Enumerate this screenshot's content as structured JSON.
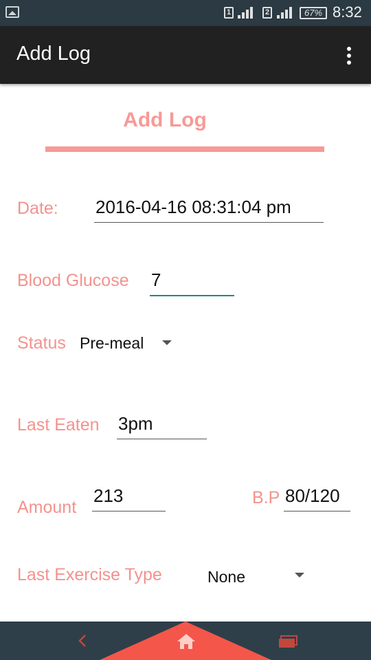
{
  "status_bar": {
    "sim1": "1",
    "sim2": "2",
    "battery": "67%",
    "time": "8:32"
  },
  "app_bar": {
    "title": "Add Log"
  },
  "form": {
    "heading": "Add Log",
    "date_label": "Date:",
    "date_value": "2016-04-16 08:31:04 pm",
    "glucose_label": "Blood Glucose",
    "glucose_value": "7",
    "status_label": "Status",
    "status_value": "Pre-meal",
    "last_eaten_label": "Last Eaten",
    "last_eaten_value": "3pm",
    "amount_label": "Amount",
    "amount_value": "213",
    "bp_label": "B.P",
    "bp_value": "80/120",
    "exercise_label": "Last Exercise Type",
    "exercise_value": "None"
  },
  "colors": {
    "accent": "#f4928d",
    "nav_accent": "#f4564a",
    "active_underline": "#1e8a7c",
    "app_bar": "#212121",
    "status_bar": "#2b3a43"
  },
  "icons": {
    "status_left": "gallery-icon",
    "menu": "overflow-menu-icon",
    "nav_back": "back-chevron-icon",
    "nav_home": "home-icon",
    "nav_recent": "recent-apps-icon"
  }
}
